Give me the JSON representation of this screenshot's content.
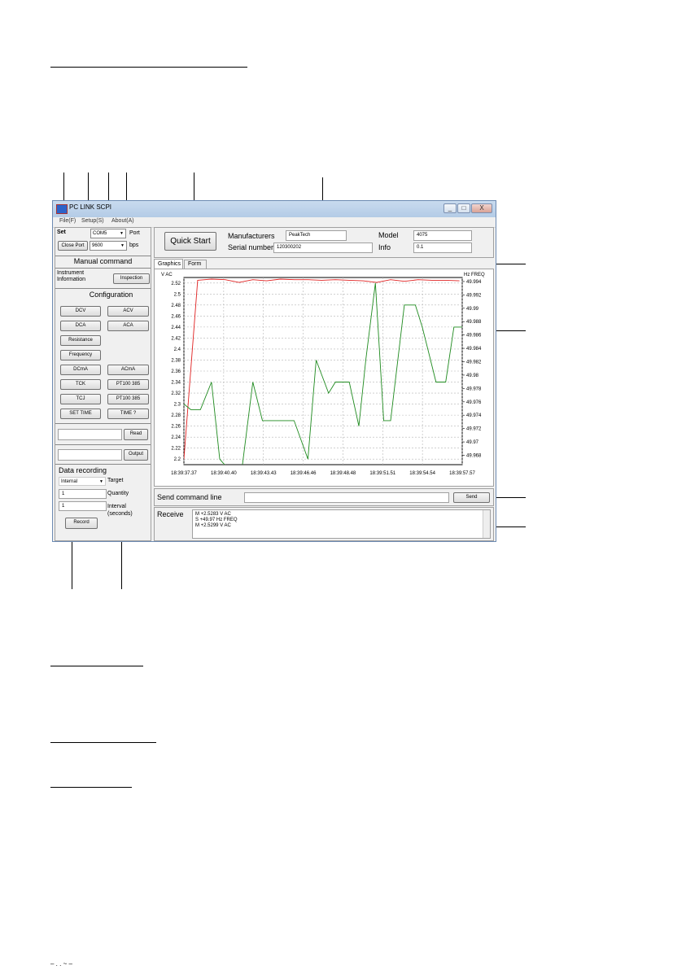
{
  "window": {
    "title": "PC LINK SCPI",
    "menu": [
      "File(F)",
      "Setup(S)",
      "About(A)"
    ],
    "controls": [
      "_",
      "□",
      "X"
    ]
  },
  "left_panel": {
    "set_label": "Set",
    "port_value": "COM5",
    "port_label": "Port",
    "close_port": "Close Port",
    "baud_value": "9600",
    "baud_label": "bps",
    "manual_command_title": "Manual command",
    "instrument_info_label": "Instrument Information",
    "inspection_button": "Inspection",
    "configuration_title": "Configuration",
    "config_buttons": [
      "DCV",
      "ACV",
      "DCA",
      "ACA",
      "Resistance",
      "Frequency",
      "DCmA",
      "ACmA",
      "TCK",
      "PT100 385",
      "TCJ",
      "PT100 385",
      "SET TIME",
      "TIME ?"
    ],
    "read_button": "Read",
    "output_button": "Output",
    "data_recording_title": "Data recording",
    "target_value": "Internal",
    "target_label": "Target",
    "quantity_value": "1",
    "quantity_label": "Quantity",
    "interval_value": "1",
    "interval_label": "Interval (seconds)",
    "record_button": "Record"
  },
  "top_panel": {
    "quick_start": "Quick Start",
    "manufacturers_label": "Manufacturers",
    "manufacturers_value": "PeakTech",
    "serial_label": "Serial number",
    "serial_value": "120300202",
    "model_label": "Model",
    "model_value": "4075",
    "info_label": "Info",
    "info_value": "0.1"
  },
  "tabs": [
    "Graphics",
    "Form"
  ],
  "send": {
    "label": "Send command line",
    "value": "",
    "button": "Send"
  },
  "receive": {
    "label": "Receive",
    "lines": [
      "M +2.5283 V AC",
      "S +49.97 Hz FREQ",
      "M +2.5299 V AC"
    ]
  },
  "chart_data": {
    "type": "line",
    "left_unit": "V AC",
    "right_unit": "Hz FREQ",
    "x_tick_labels": [
      "18:39:37.37",
      "18:39:40.40",
      "18:39:43.43",
      "18:39:46.46",
      "18:39:48.48",
      "18:39:51.51",
      "18:39:54.54",
      "18:39:57.57"
    ],
    "left_ticks": [
      "2.52",
      "2.5",
      "2.48",
      "2.46",
      "2.44",
      "2.42",
      "2.4",
      "2.38",
      "2.36",
      "2.34",
      "2.32",
      "2.3",
      "2.28",
      "2.26",
      "2.24",
      "2.22",
      "2.2"
    ],
    "right_ticks": [
      "49.994",
      "49.992",
      "49.99",
      "49.988",
      "49.986",
      "49.984",
      "49.982",
      "49.98",
      "49.978",
      "49.976",
      "49.974",
      "49.972",
      "49.97",
      "49.968"
    ],
    "ylim_left": [
      2.19,
      2.53
    ],
    "ylim_right": [
      49.9666,
      49.9946
    ],
    "x_range": [
      0,
      20.2
    ],
    "grid": true,
    "series": [
      {
        "color": "#e02020",
        "axis": "left",
        "x": [
          0,
          1,
          2,
          3,
          4,
          5,
          6,
          7,
          8,
          9,
          10,
          11,
          12,
          13,
          14,
          15,
          16,
          17,
          18,
          19,
          20
        ],
        "y": [
          2.2,
          2.525,
          2.527,
          2.526,
          2.521,
          2.526,
          2.524,
          2.527,
          2.526,
          2.526,
          2.525,
          2.526,
          2.525,
          2.524,
          2.521,
          2.526,
          2.523,
          2.526,
          2.525,
          2.525,
          2.524
        ]
      },
      {
        "color": "#1e8a1e",
        "axis": "left",
        "x": [
          0,
          0.5,
          1.2,
          2,
          2.6,
          3.3,
          4.2,
          5,
          5.7,
          6.5,
          8,
          9,
          9.6,
          10.5,
          11,
          11.4,
          12,
          12.7,
          13.2,
          13.9,
          14.5,
          15,
          16,
          16.8,
          17.3,
          17.7,
          18.3,
          19,
          19.6,
          20.2
        ],
        "y": [
          2.3,
          2.29,
          2.29,
          2.34,
          2.2,
          2.18,
          2.18,
          2.34,
          2.27,
          2.27,
          2.27,
          2.2,
          2.38,
          2.32,
          2.34,
          2.34,
          2.34,
          2.26,
          2.38,
          2.52,
          2.27,
          2.27,
          2.48,
          2.48,
          2.44,
          2.4,
          2.34,
          2.34,
          2.44,
          2.44
        ]
      }
    ]
  },
  "footer": {
    "bottom_text": "– . . ~ –"
  }
}
